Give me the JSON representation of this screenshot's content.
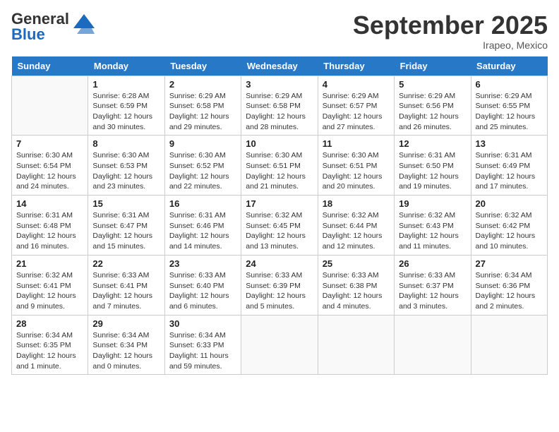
{
  "header": {
    "logo_general": "General",
    "logo_blue": "Blue",
    "month_title": "September 2025",
    "location": "Irapeo, Mexico"
  },
  "days_of_week": [
    "Sunday",
    "Monday",
    "Tuesday",
    "Wednesday",
    "Thursday",
    "Friday",
    "Saturday"
  ],
  "weeks": [
    [
      {
        "day": "",
        "info": ""
      },
      {
        "day": "1",
        "info": "Sunrise: 6:28 AM\nSunset: 6:59 PM\nDaylight: 12 hours\nand 30 minutes."
      },
      {
        "day": "2",
        "info": "Sunrise: 6:29 AM\nSunset: 6:58 PM\nDaylight: 12 hours\nand 29 minutes."
      },
      {
        "day": "3",
        "info": "Sunrise: 6:29 AM\nSunset: 6:58 PM\nDaylight: 12 hours\nand 28 minutes."
      },
      {
        "day": "4",
        "info": "Sunrise: 6:29 AM\nSunset: 6:57 PM\nDaylight: 12 hours\nand 27 minutes."
      },
      {
        "day": "5",
        "info": "Sunrise: 6:29 AM\nSunset: 6:56 PM\nDaylight: 12 hours\nand 26 minutes."
      },
      {
        "day": "6",
        "info": "Sunrise: 6:29 AM\nSunset: 6:55 PM\nDaylight: 12 hours\nand 25 minutes."
      }
    ],
    [
      {
        "day": "7",
        "info": "Sunrise: 6:30 AM\nSunset: 6:54 PM\nDaylight: 12 hours\nand 24 minutes."
      },
      {
        "day": "8",
        "info": "Sunrise: 6:30 AM\nSunset: 6:53 PM\nDaylight: 12 hours\nand 23 minutes."
      },
      {
        "day": "9",
        "info": "Sunrise: 6:30 AM\nSunset: 6:52 PM\nDaylight: 12 hours\nand 22 minutes."
      },
      {
        "day": "10",
        "info": "Sunrise: 6:30 AM\nSunset: 6:51 PM\nDaylight: 12 hours\nand 21 minutes."
      },
      {
        "day": "11",
        "info": "Sunrise: 6:30 AM\nSunset: 6:51 PM\nDaylight: 12 hours\nand 20 minutes."
      },
      {
        "day": "12",
        "info": "Sunrise: 6:31 AM\nSunset: 6:50 PM\nDaylight: 12 hours\nand 19 minutes."
      },
      {
        "day": "13",
        "info": "Sunrise: 6:31 AM\nSunset: 6:49 PM\nDaylight: 12 hours\nand 17 minutes."
      }
    ],
    [
      {
        "day": "14",
        "info": "Sunrise: 6:31 AM\nSunset: 6:48 PM\nDaylight: 12 hours\nand 16 minutes."
      },
      {
        "day": "15",
        "info": "Sunrise: 6:31 AM\nSunset: 6:47 PM\nDaylight: 12 hours\nand 15 minutes."
      },
      {
        "day": "16",
        "info": "Sunrise: 6:31 AM\nSunset: 6:46 PM\nDaylight: 12 hours\nand 14 minutes."
      },
      {
        "day": "17",
        "info": "Sunrise: 6:32 AM\nSunset: 6:45 PM\nDaylight: 12 hours\nand 13 minutes."
      },
      {
        "day": "18",
        "info": "Sunrise: 6:32 AM\nSunset: 6:44 PM\nDaylight: 12 hours\nand 12 minutes."
      },
      {
        "day": "19",
        "info": "Sunrise: 6:32 AM\nSunset: 6:43 PM\nDaylight: 12 hours\nand 11 minutes."
      },
      {
        "day": "20",
        "info": "Sunrise: 6:32 AM\nSunset: 6:42 PM\nDaylight: 12 hours\nand 10 minutes."
      }
    ],
    [
      {
        "day": "21",
        "info": "Sunrise: 6:32 AM\nSunset: 6:41 PM\nDaylight: 12 hours\nand 9 minutes."
      },
      {
        "day": "22",
        "info": "Sunrise: 6:33 AM\nSunset: 6:41 PM\nDaylight: 12 hours\nand 7 minutes."
      },
      {
        "day": "23",
        "info": "Sunrise: 6:33 AM\nSunset: 6:40 PM\nDaylight: 12 hours\nand 6 minutes."
      },
      {
        "day": "24",
        "info": "Sunrise: 6:33 AM\nSunset: 6:39 PM\nDaylight: 12 hours\nand 5 minutes."
      },
      {
        "day": "25",
        "info": "Sunrise: 6:33 AM\nSunset: 6:38 PM\nDaylight: 12 hours\nand 4 minutes."
      },
      {
        "day": "26",
        "info": "Sunrise: 6:33 AM\nSunset: 6:37 PM\nDaylight: 12 hours\nand 3 minutes."
      },
      {
        "day": "27",
        "info": "Sunrise: 6:34 AM\nSunset: 6:36 PM\nDaylight: 12 hours\nand 2 minutes."
      }
    ],
    [
      {
        "day": "28",
        "info": "Sunrise: 6:34 AM\nSunset: 6:35 PM\nDaylight: 12 hours\nand 1 minute."
      },
      {
        "day": "29",
        "info": "Sunrise: 6:34 AM\nSunset: 6:34 PM\nDaylight: 12 hours\nand 0 minutes."
      },
      {
        "day": "30",
        "info": "Sunrise: 6:34 AM\nSunset: 6:33 PM\nDaylight: 11 hours\nand 59 minutes."
      },
      {
        "day": "",
        "info": ""
      },
      {
        "day": "",
        "info": ""
      },
      {
        "day": "",
        "info": ""
      },
      {
        "day": "",
        "info": ""
      }
    ]
  ]
}
